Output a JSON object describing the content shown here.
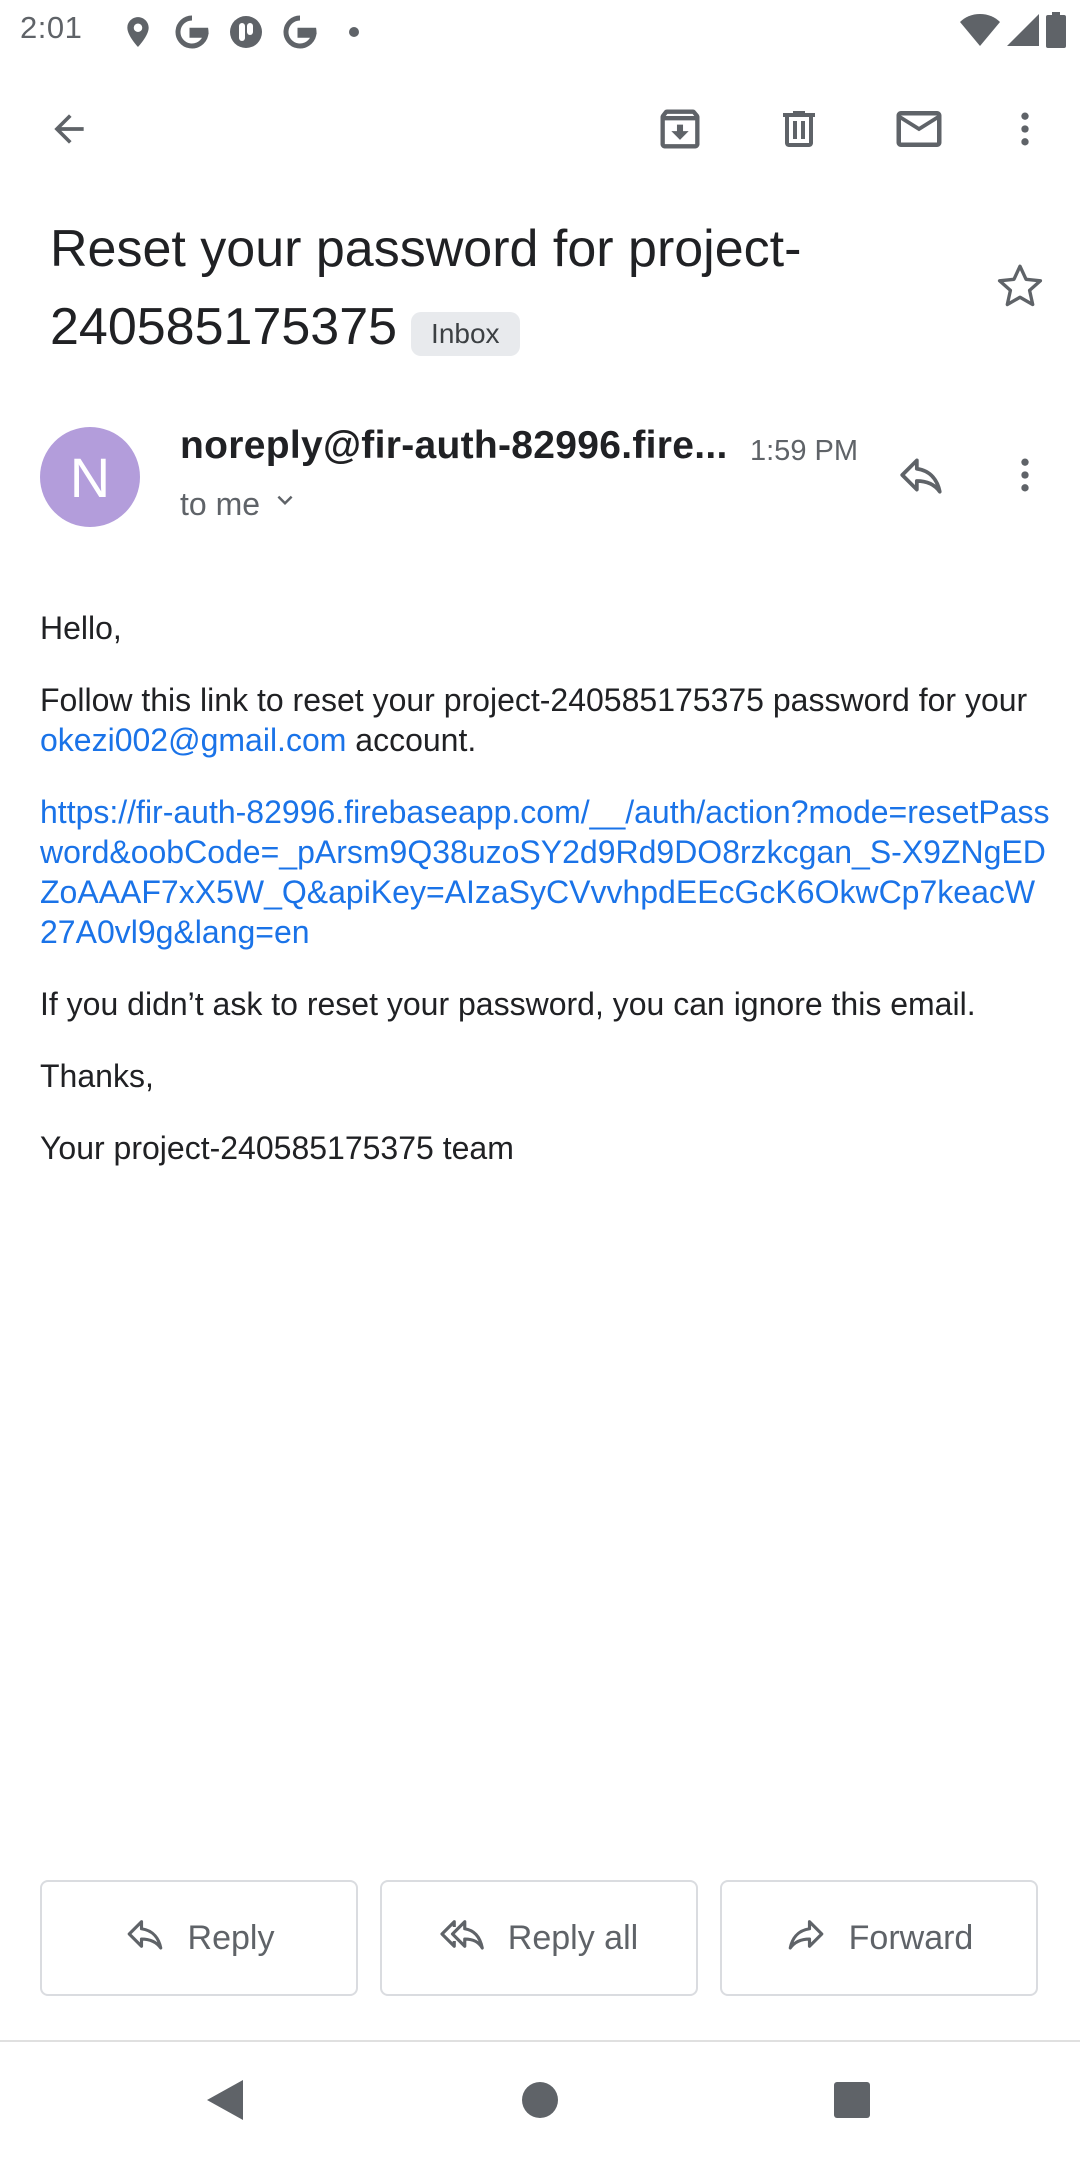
{
  "status_bar": {
    "time": "2:01",
    "left_icons": [
      "location-icon",
      "google-icon",
      "app-icon",
      "google-icon"
    ],
    "right_icons": [
      "wifi-icon",
      "signal-icon",
      "battery-icon"
    ]
  },
  "toolbar": {
    "icons": [
      "back-arrow-icon",
      "archive-icon",
      "delete-icon",
      "mark-unread-icon",
      "more-vert-icon"
    ]
  },
  "email": {
    "subject": "Reset your password for project-240585175375",
    "label": "Inbox",
    "sender": {
      "initial": "N",
      "name": "noreply@fir-auth-82996.fire...",
      "time": "1:59 PM",
      "recipient": "to me",
      "avatar_color": "#b39ddb"
    },
    "body": {
      "greeting": "Hello,",
      "line1_pre": "Follow this link to reset your project-240585175375 password for your ",
      "line1_email": "okezi002@gmail.com",
      "line1_post": " account.",
      "reset_link": "https://fir-auth-82996.firebaseapp.com/__/auth/action?mode=resetPassword&oobCode=_pArsm9Q38uzoSY2d9Rd9DO8rzkcgan_S-X9ZNgEDZoAAAF7xX5W_Q&apiKey=AIzaSyCVvvhpdEEcGcK6OkwCp7keacW27A0vl9g&lang=en",
      "ignore_line": "If you didn’t ask to reset your password, you can ignore this email.",
      "thanks": "Thanks,",
      "signature": "Your project-240585175375 team"
    }
  },
  "actions": {
    "reply": "Reply",
    "reply_all": "Reply all",
    "forward": "Forward"
  },
  "colors": {
    "link": "#1a73e8",
    "text": "#202124",
    "secondary": "#5f6368",
    "badge_bg": "#e8eaed"
  }
}
